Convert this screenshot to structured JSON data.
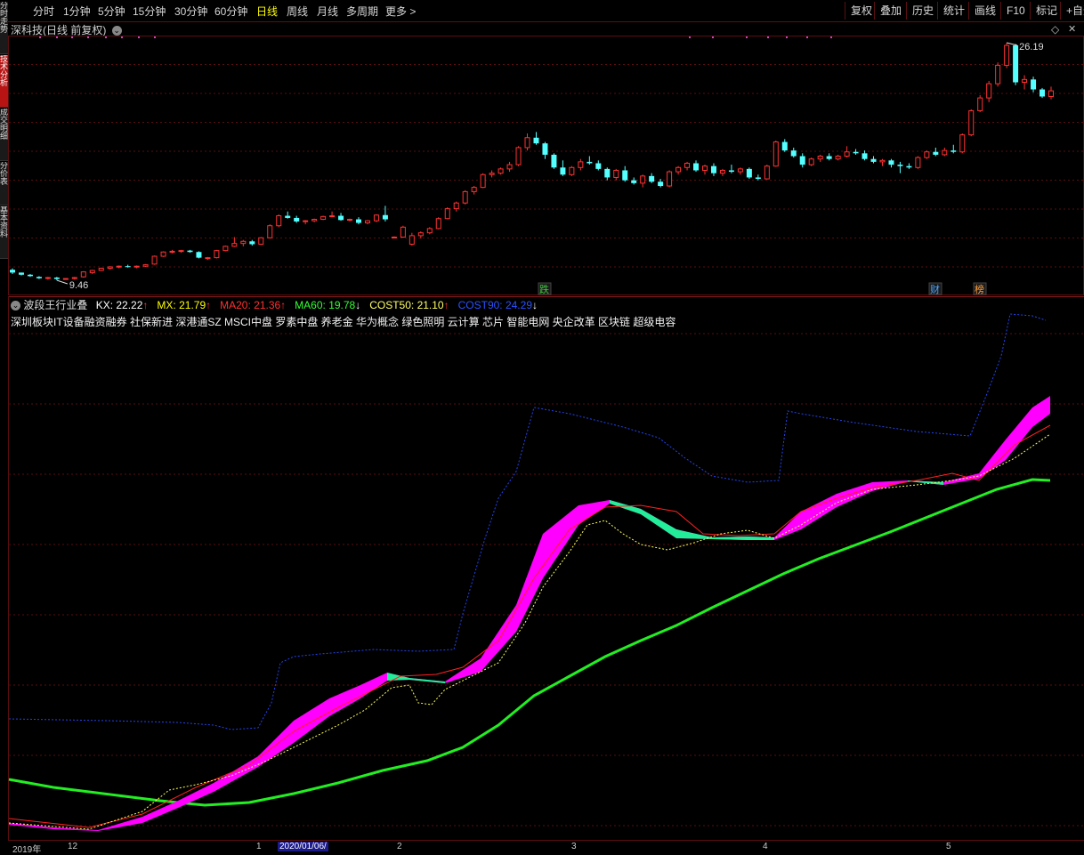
{
  "toolbar": {
    "periods": [
      {
        "label": "分时",
        "active": false
      },
      {
        "label": "1分钟",
        "active": false
      },
      {
        "label": "5分钟",
        "active": false
      },
      {
        "label": "15分钟",
        "active": false
      },
      {
        "label": "30分钟",
        "active": false
      },
      {
        "label": "60分钟",
        "active": false
      },
      {
        "label": "日线",
        "active": true
      },
      {
        "label": "周线",
        "active": false
      },
      {
        "label": "月线",
        "active": false
      },
      {
        "label": "多周期",
        "active": false
      },
      {
        "label": "更多 >",
        "active": false
      }
    ],
    "right_buttons": [
      "复权",
      "叠加",
      "历史",
      "统计",
      "画线",
      "F10",
      "标记",
      "+自选"
    ]
  },
  "side_tabs": [
    {
      "label": "分时走势",
      "active": false
    },
    {
      "label": "技术分析",
      "active": true
    },
    {
      "label": "成交明细",
      "active": false
    },
    {
      "label": "分价表",
      "active": false
    },
    {
      "label": "基本资料",
      "active": false
    }
  ],
  "main_panel": {
    "title": "深科技(日线 前复权)",
    "high_label": "26.19",
    "low_label": "9.46",
    "markers": [
      {
        "text": "跌",
        "color": "#3cc63c"
      },
      {
        "text": "财",
        "color": "#4aa3ff"
      },
      {
        "text": "榜",
        "color": "#ffa040"
      }
    ]
  },
  "indicator_panel": {
    "name": "波段王行业叠",
    "values": [
      {
        "label": "KX: 22.22",
        "arrow": "↑",
        "color": "#ffffff",
        "arrow_color": "#ff3030"
      },
      {
        "label": "MX: 21.79",
        "arrow": "↑",
        "color": "#ffff00",
        "arrow_color": "#ff3030"
      },
      {
        "label": "MA20: 21.36",
        "arrow": "↑",
        "color": "#ff3030",
        "arrow_color": "#ff3030"
      },
      {
        "label": "MA60: 19.78",
        "arrow": "↓",
        "color": "#33ff33",
        "arrow_color": "#ffffff"
      },
      {
        "label": "COST50: 21.10",
        "arrow": "↑",
        "color": "#ffff66",
        "arrow_color": "#ff3030"
      },
      {
        "label": "COST90: 24.29",
        "arrow": "↓",
        "color": "#2a52ff",
        "arrow_color": "#ffffff"
      }
    ],
    "concepts": "深圳板块IT设备融资融券 社保新进 深港通SZ MSCI中盘 罗素中盘 养老金 华为概念 绿色照明 云计算 芯片 智能电网 央企改革 区块链 超级电容"
  },
  "date_axis": {
    "labels": [
      "2019年",
      "12",
      "1",
      "2020/01/06/",
      "2",
      "3",
      "4",
      "5"
    ]
  },
  "colors": {
    "up": "#ff3232",
    "down": "#54ffff",
    "grid": "#5a0e0e",
    "kx_band_up": "#ff00ff",
    "kx_band_down": "#22ee99",
    "ma20": "#ff2020",
    "ma60": "#22ee22",
    "cost50": "#ffff55",
    "cost90": "#2244ee"
  },
  "chart_data": {
    "type": "candlestick",
    "price_range": [
      9.46,
      26.19
    ],
    "candles": [
      [
        10.2,
        10.3,
        9.9,
        10.0
      ],
      [
        10.0,
        10.0,
        9.8,
        9.85
      ],
      [
        9.85,
        9.9,
        9.7,
        9.75
      ],
      [
        9.7,
        9.75,
        9.55,
        9.6
      ],
      [
        9.6,
        9.7,
        9.5,
        9.65
      ],
      [
        9.65,
        9.7,
        9.46,
        9.55
      ],
      [
        9.55,
        9.6,
        9.5,
        9.58
      ],
      [
        9.58,
        9.7,
        9.5,
        9.65
      ],
      [
        9.7,
        10.1,
        9.65,
        10.05
      ],
      [
        10.0,
        10.2,
        9.9,
        10.15
      ],
      [
        10.15,
        10.35,
        10.1,
        10.3
      ],
      [
        10.3,
        10.45,
        10.2,
        10.4
      ],
      [
        10.4,
        10.5,
        10.3,
        10.45
      ],
      [
        10.45,
        10.55,
        10.35,
        10.4
      ],
      [
        10.4,
        10.5,
        10.3,
        10.45
      ],
      [
        10.45,
        10.6,
        10.4,
        10.55
      ],
      [
        10.6,
        11.2,
        10.55,
        11.15
      ],
      [
        11.15,
        11.5,
        11.1,
        11.45
      ],
      [
        11.45,
        11.6,
        11.35,
        11.5
      ],
      [
        11.5,
        11.6,
        11.4,
        11.55
      ],
      [
        11.55,
        11.6,
        11.4,
        11.45
      ],
      [
        11.45,
        11.5,
        11.0,
        11.05
      ],
      [
        11.0,
        11.1,
        10.9,
        11.05
      ],
      [
        11.05,
        11.6,
        11.0,
        11.55
      ],
      [
        11.55,
        11.9,
        11.5,
        11.85
      ],
      [
        11.85,
        12.5,
        11.8,
        12.05
      ],
      [
        12.05,
        12.3,
        11.85,
        12.2
      ],
      [
        12.2,
        12.3,
        11.9,
        12.0
      ],
      [
        12.0,
        12.5,
        11.95,
        12.45
      ],
      [
        12.45,
        13.4,
        12.4,
        13.3
      ],
      [
        13.3,
        14.1,
        13.2,
        14.0
      ],
      [
        14.0,
        14.3,
        13.8,
        13.85
      ],
      [
        13.85,
        14.0,
        13.5,
        13.6
      ],
      [
        13.6,
        13.7,
        13.4,
        13.65
      ],
      [
        13.65,
        13.8,
        13.55,
        13.75
      ],
      [
        13.75,
        14.0,
        13.7,
        13.95
      ],
      [
        13.95,
        14.3,
        13.9,
        14.0
      ],
      [
        14.0,
        14.2,
        13.65,
        13.7
      ],
      [
        13.7,
        13.8,
        13.6,
        13.75
      ],
      [
        13.75,
        13.9,
        13.4,
        13.5
      ],
      [
        13.5,
        13.7,
        13.4,
        13.65
      ],
      [
        13.65,
        14.1,
        13.55,
        14.05
      ],
      [
        14.05,
        14.7,
        13.6,
        13.75
      ],
      [
        12.5,
        12.55,
        12.45,
        12.5
      ],
      [
        12.5,
        13.3,
        12.45,
        13.2
      ],
      [
        12.0,
        12.8,
        11.9,
        12.6
      ],
      [
        12.6,
        12.9,
        12.4,
        12.8
      ],
      [
        12.8,
        13.2,
        12.7,
        13.1
      ],
      [
        13.1,
        13.9,
        13.05,
        13.8
      ],
      [
        13.8,
        14.6,
        13.75,
        14.5
      ],
      [
        14.5,
        15.0,
        14.3,
        14.9
      ],
      [
        14.9,
        15.8,
        14.8,
        15.7
      ],
      [
        15.7,
        16.1,
        15.5,
        16.0
      ],
      [
        16.0,
        17.0,
        15.95,
        16.9
      ],
      [
        16.9,
        17.2,
        16.7,
        17.0
      ],
      [
        17.0,
        17.4,
        16.9,
        17.3
      ],
      [
        17.3,
        17.8,
        17.1,
        17.6
      ],
      [
        17.6,
        18.9,
        17.5,
        18.8
      ],
      [
        18.8,
        19.8,
        18.6,
        19.5
      ],
      [
        19.5,
        19.9,
        19.0,
        19.1
      ],
      [
        19.1,
        19.2,
        18.0,
        18.3
      ],
      [
        18.3,
        18.4,
        17.3,
        17.4
      ],
      [
        17.4,
        17.9,
        16.8,
        16.9
      ],
      [
        16.9,
        17.5,
        16.8,
        17.4
      ],
      [
        17.4,
        18.0,
        17.2,
        17.8
      ],
      [
        17.8,
        18.2,
        17.6,
        17.7
      ],
      [
        17.7,
        17.9,
        17.2,
        17.3
      ],
      [
        17.3,
        17.4,
        16.5,
        16.7
      ],
      [
        16.7,
        17.3,
        16.5,
        17.2
      ],
      [
        17.2,
        17.5,
        16.4,
        16.5
      ],
      [
        16.5,
        16.7,
        16.2,
        16.3
      ],
      [
        16.3,
        16.9,
        16.0,
        16.8
      ],
      [
        16.8,
        17.0,
        16.3,
        16.4
      ],
      [
        16.4,
        16.6,
        16.0,
        16.1
      ],
      [
        16.1,
        17.2,
        16.0,
        17.1
      ],
      [
        17.1,
        17.5,
        16.9,
        17.4
      ],
      [
        17.4,
        17.8,
        17.2,
        17.7
      ],
      [
        17.7,
        17.9,
        17.1,
        17.2
      ],
      [
        17.2,
        17.6,
        16.9,
        17.5
      ],
      [
        17.5,
        17.7,
        16.8,
        17.0
      ],
      [
        17.0,
        17.3,
        16.8,
        17.2
      ],
      [
        17.2,
        17.6,
        17.0,
        17.1
      ],
      [
        17.1,
        17.4,
        16.9,
        17.3
      ],
      [
        17.3,
        17.4,
        16.6,
        16.7
      ],
      [
        16.7,
        16.9,
        16.5,
        16.6
      ],
      [
        16.6,
        17.6,
        16.55,
        17.5
      ],
      [
        17.5,
        19.3,
        17.45,
        19.2
      ],
      [
        19.2,
        19.4,
        18.5,
        18.6
      ],
      [
        18.6,
        18.8,
        18.1,
        18.2
      ],
      [
        18.2,
        18.4,
        17.4,
        17.6
      ],
      [
        17.6,
        18.1,
        17.5,
        18.0
      ],
      [
        18.0,
        18.3,
        17.8,
        18.2
      ],
      [
        18.2,
        18.4,
        17.9,
        18.0
      ],
      [
        18.0,
        18.3,
        17.9,
        18.2
      ],
      [
        18.2,
        18.9,
        18.1,
        18.5
      ],
      [
        18.5,
        18.7,
        18.3,
        18.4
      ],
      [
        18.4,
        18.6,
        17.9,
        18.0
      ],
      [
        18.0,
        18.2,
        17.7,
        17.8
      ],
      [
        17.8,
        18.0,
        17.5,
        17.9
      ],
      [
        17.9,
        18.0,
        17.4,
        17.6
      ],
      [
        17.6,
        17.8,
        17.0,
        17.5
      ],
      [
        17.5,
        17.7,
        17.3,
        17.4
      ],
      [
        17.4,
        18.2,
        17.3,
        18.1
      ],
      [
        18.1,
        18.6,
        18.0,
        18.5
      ],
      [
        18.5,
        18.8,
        18.2,
        18.3
      ],
      [
        18.3,
        18.8,
        18.2,
        18.6
      ],
      [
        18.6,
        19.0,
        18.4,
        18.5
      ],
      [
        18.5,
        19.8,
        18.4,
        19.7
      ],
      [
        19.7,
        21.5,
        19.6,
        21.4
      ],
      [
        21.4,
        22.5,
        21.3,
        22.3
      ],
      [
        22.3,
        23.5,
        22.0,
        23.3
      ],
      [
        23.3,
        24.8,
        23.1,
        24.6
      ],
      [
        24.6,
        26.19,
        24.4,
        26.0
      ],
      [
        26.0,
        26.1,
        23.2,
        23.4
      ],
      [
        23.4,
        23.9,
        22.9,
        23.6
      ],
      [
        23.6,
        23.8,
        22.7,
        22.9
      ],
      [
        22.9,
        23.0,
        22.3,
        22.4
      ],
      [
        22.4,
        23.1,
        22.2,
        22.8
      ]
    ]
  }
}
